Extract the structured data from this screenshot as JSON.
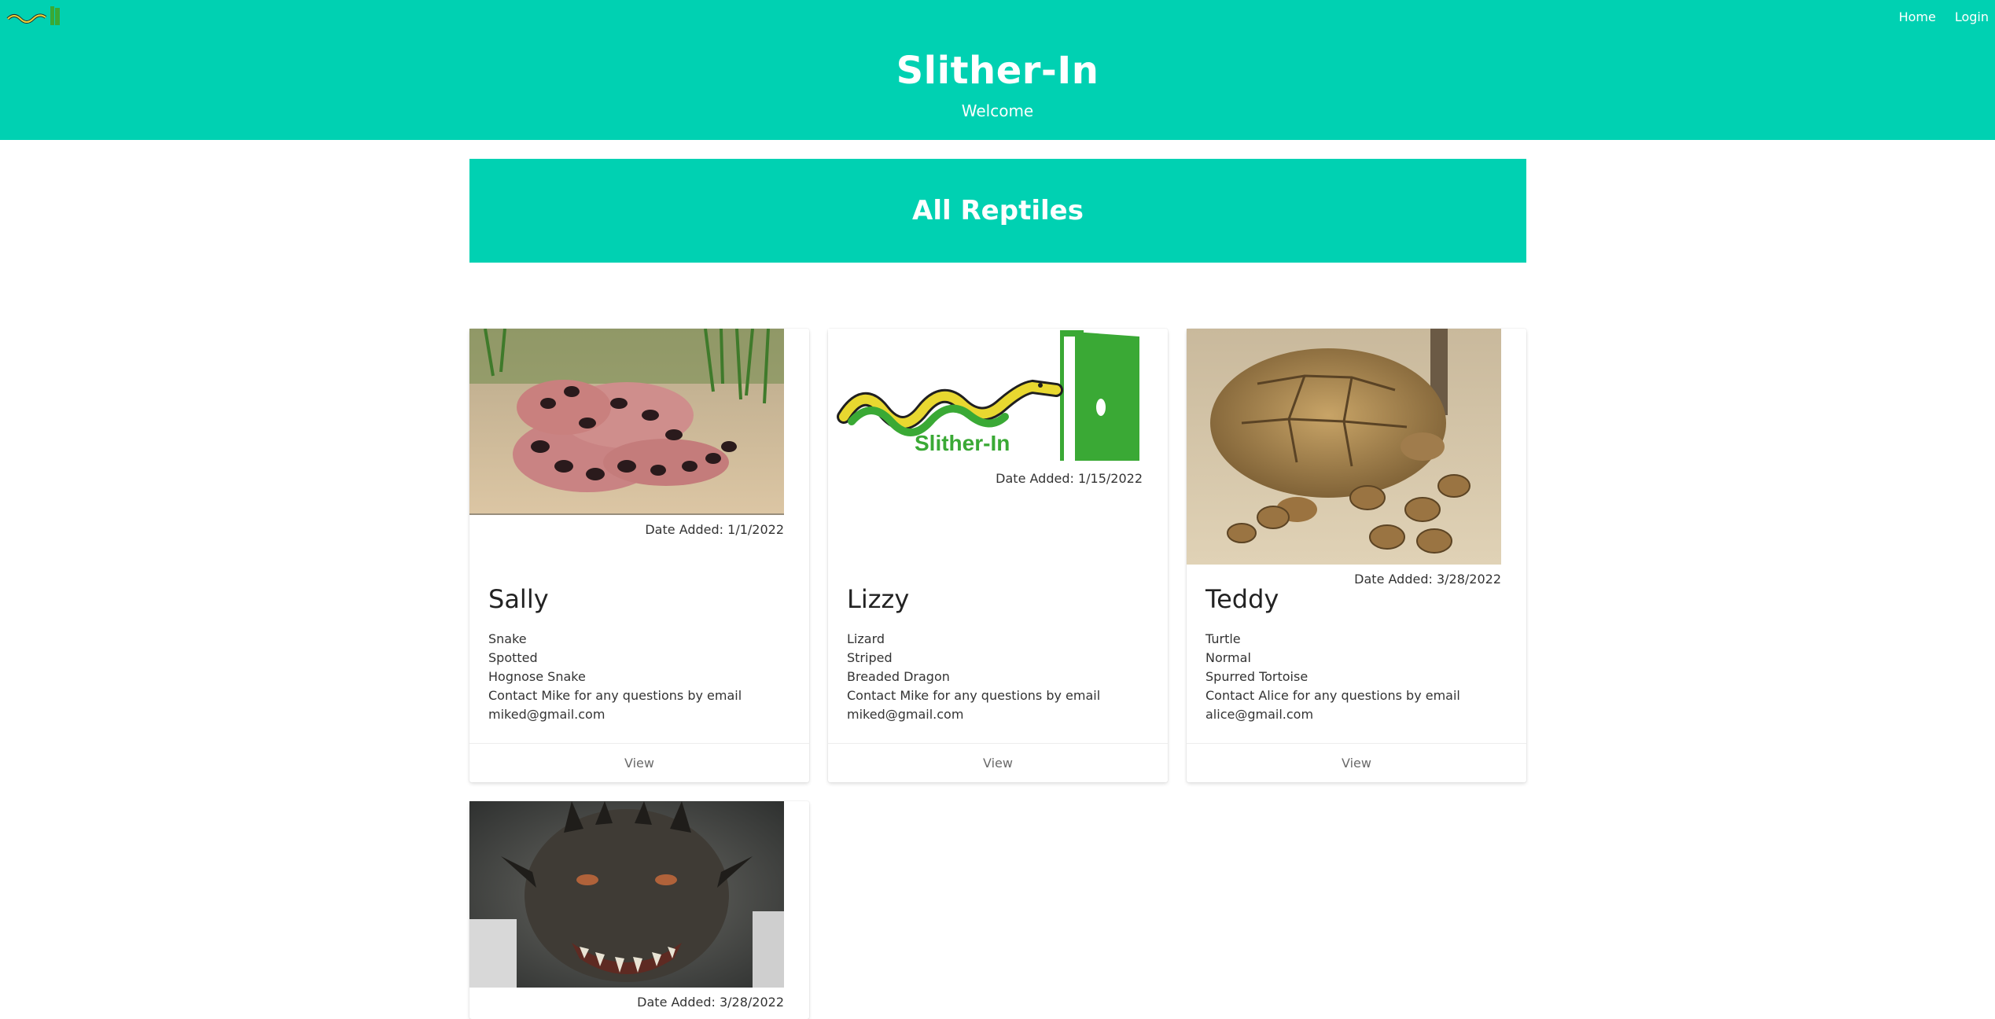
{
  "header": {
    "title": "Slither-In",
    "subtitle": "Welcome",
    "brand_color": "#00d1b2",
    "nav": [
      {
        "label": "Home"
      },
      {
        "label": "Login"
      }
    ]
  },
  "section": {
    "heading": "All Reptiles"
  },
  "cards": [
    {
      "image": "hognose-snake-photo",
      "date_added": "Date Added: 1/1/2022",
      "name": "Sally",
      "type": "Snake",
      "pattern": "Spotted",
      "species": "Hognose Snake",
      "contact": "Contact Mike for any questions by email",
      "email": "miked@gmail.com",
      "action": "View"
    },
    {
      "image": "slither-in-logo",
      "logo_text": "Slither-In",
      "date_added": "Date Added: 1/15/2022",
      "name": "Lizzy",
      "type": "Lizard",
      "pattern": "Striped",
      "species": "Breaded Dragon",
      "contact": "Contact Mike for any questions by email",
      "email": "miked@gmail.com",
      "action": "View"
    },
    {
      "image": "tortoise-photo",
      "date_added": "Date Added: 3/28/2022",
      "name": "Teddy",
      "type": "Turtle",
      "pattern": "Normal",
      "species": "Spurred Tortoise",
      "contact": "Contact Alice for any questions by email",
      "email": "alice@gmail.com",
      "action": "View"
    },
    {
      "image": "dragon-photo",
      "date_added": "Date Added: 3/28/2022"
    }
  ]
}
